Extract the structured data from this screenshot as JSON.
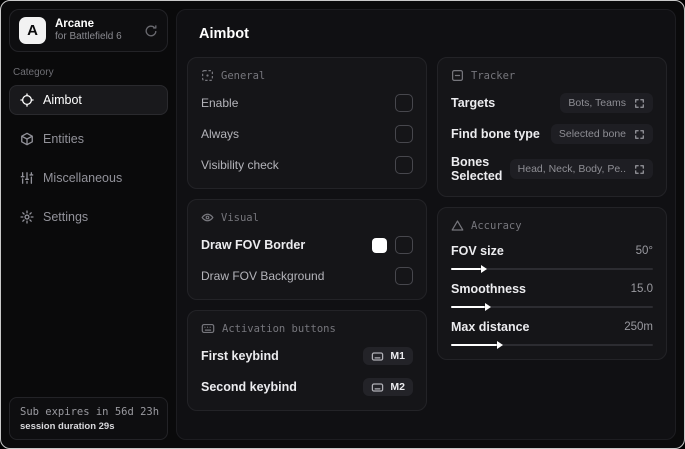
{
  "sidebar": {
    "logo_letter": "A",
    "app_name": "Arcane",
    "app_subtitle": "for Battlefield 6",
    "category_label": "Category",
    "items": [
      {
        "label": "Aimbot"
      },
      {
        "label": "Entities"
      },
      {
        "label": "Miscellaneous"
      },
      {
        "label": "Settings"
      }
    ],
    "footer": {
      "sub_expires": "Sub expires in 56d 23h",
      "session_duration": "session duration 29s"
    }
  },
  "main": {
    "title": "Aimbot",
    "general": {
      "title": "General",
      "rows": [
        {
          "label": "Enable",
          "checked": false
        },
        {
          "label": "Always",
          "checked": false
        },
        {
          "label": "Visibility check",
          "checked": false
        }
      ]
    },
    "visual": {
      "title": "Visual",
      "rows": [
        {
          "label": "Draw FOV Border",
          "swatch_color": "#ffffff",
          "checked": false
        },
        {
          "label": "Draw FOV Background",
          "checked": false
        }
      ]
    },
    "activation": {
      "title": "Activation buttons",
      "rows": [
        {
          "label": "First keybind",
          "key": "M1"
        },
        {
          "label": "Second keybind",
          "key": "M2"
        }
      ]
    },
    "tracker": {
      "title": "Tracker",
      "rows": [
        {
          "label": "Targets",
          "value": "Bots, Teams"
        },
        {
          "label": "Find bone type",
          "value": "Selected bone"
        },
        {
          "label": "Bones Selected",
          "value": "Head, Neck, Body, Pe.."
        }
      ]
    },
    "accuracy": {
      "title": "Accuracy",
      "sliders": [
        {
          "label": "FOV size",
          "value": "50°",
          "fill": "15%"
        },
        {
          "label": "Smoothness",
          "value": "15.0",
          "fill": "17%"
        },
        {
          "label": "Max distance",
          "value": "250m",
          "fill": "23%"
        }
      ]
    }
  },
  "colors": {
    "background": "#0a0a0b",
    "panel": "#101013",
    "card": "#151518",
    "accent": "#ffffff",
    "fov_border_swatch": "#ffffff"
  }
}
